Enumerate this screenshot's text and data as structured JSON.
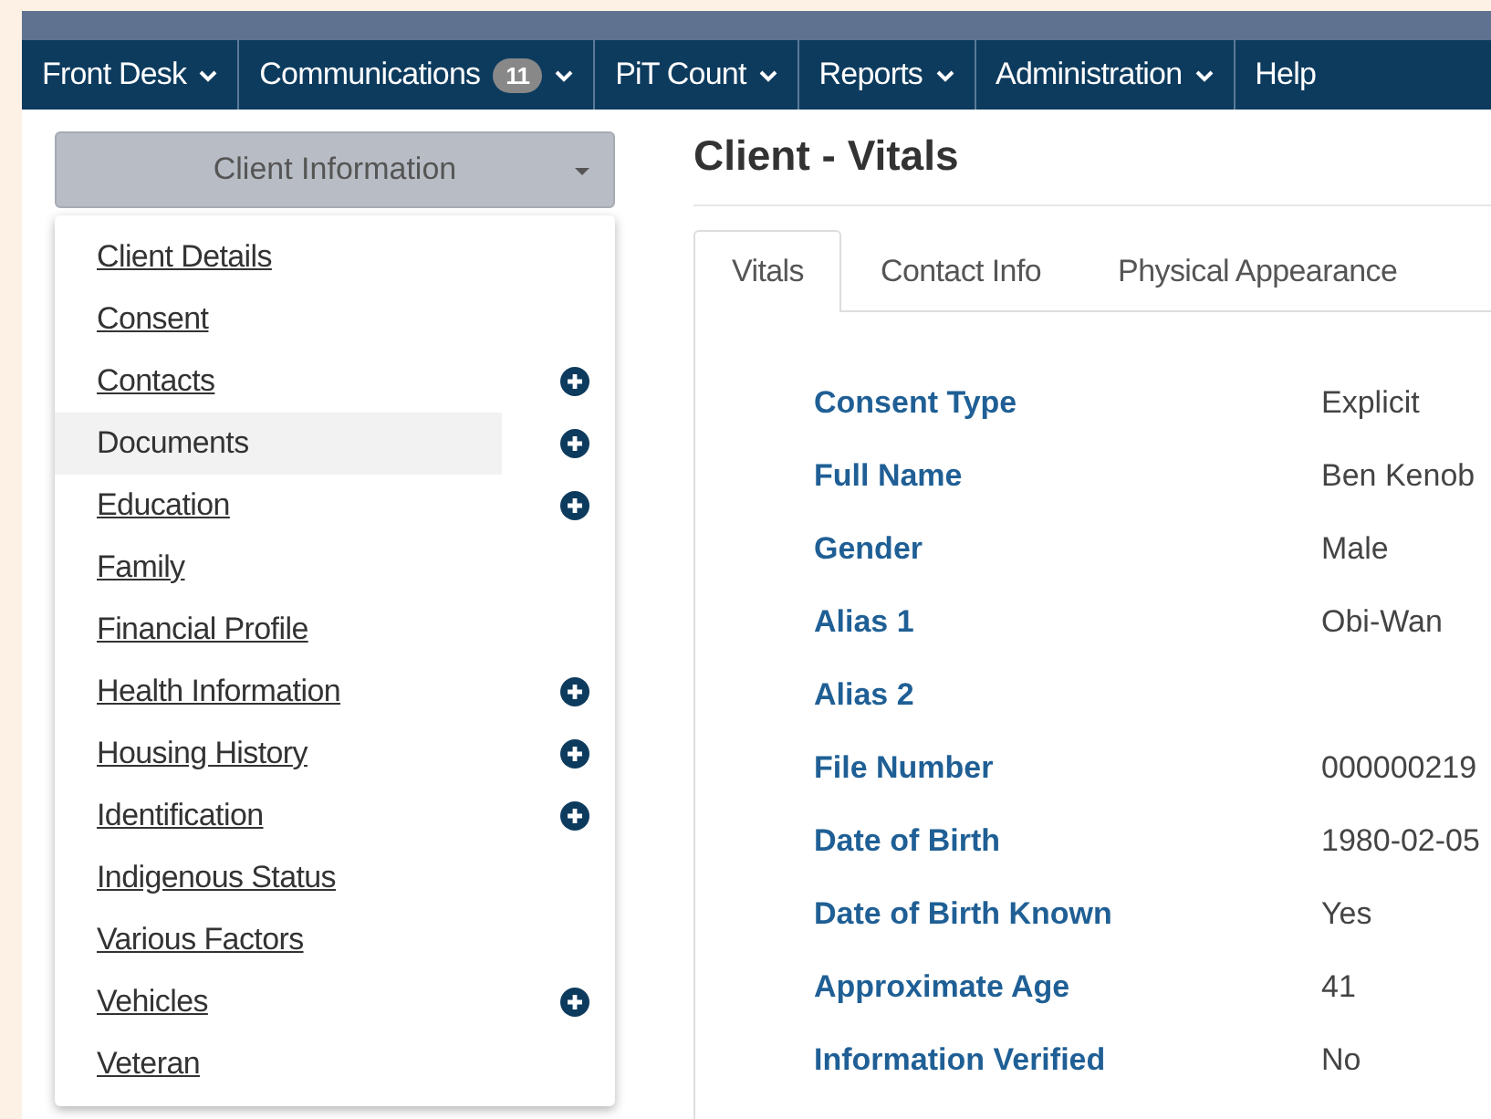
{
  "nav": [
    {
      "label": "Front Desk",
      "dropdown": true
    },
    {
      "label": "Communications",
      "badge": "11",
      "dropdown": true
    },
    {
      "label": "PiT Count",
      "dropdown": true
    },
    {
      "label": "Reports",
      "dropdown": true
    },
    {
      "label": "Administration",
      "dropdown": true
    },
    {
      "label": "Help",
      "dropdown": false
    }
  ],
  "section_menu": {
    "button": "Client Information",
    "items": [
      {
        "label": "Client Details",
        "hovered": false,
        "add": false
      },
      {
        "label": "Consent",
        "hovered": false,
        "add": false
      },
      {
        "label": "Contacts",
        "hovered": false,
        "add": true
      },
      {
        "label": "Documents",
        "hovered": true,
        "add": true
      },
      {
        "label": "Education",
        "hovered": false,
        "add": true
      },
      {
        "label": "Family",
        "hovered": false,
        "add": false
      },
      {
        "label": "Financial Profile",
        "hovered": false,
        "add": false
      },
      {
        "label": "Health Information",
        "hovered": false,
        "add": true
      },
      {
        "label": "Housing History",
        "hovered": false,
        "add": true
      },
      {
        "label": "Identification",
        "hovered": false,
        "add": true
      },
      {
        "label": "Indigenous Status",
        "hovered": false,
        "add": false
      },
      {
        "label": "Various Factors",
        "hovered": false,
        "add": false
      },
      {
        "label": "Vehicles",
        "hovered": false,
        "add": true
      },
      {
        "label": "Veteran",
        "hovered": false,
        "add": false
      }
    ]
  },
  "page_title": "Client - Vitals",
  "tabs": [
    {
      "label": "Vitals",
      "selected": true
    },
    {
      "label": "Contact Info",
      "selected": false
    },
    {
      "label": "Physical Appearance",
      "selected": false
    }
  ],
  "fields": [
    {
      "label": "Consent Type",
      "value": "Explicit"
    },
    {
      "label": "Full Name",
      "value": "Ben Kenob"
    },
    {
      "label": "Gender",
      "value": "Male"
    },
    {
      "label": "Alias 1",
      "value": "Obi-Wan"
    },
    {
      "label": "Alias 2"
    },
    {
      "label": "File Number",
      "value": "000000219"
    },
    {
      "label": "Date of Birth",
      "value": "1980-02-05"
    },
    {
      "label": "Date of Birth Known",
      "value": "Yes"
    },
    {
      "label": "Approximate Age",
      "value": "41"
    },
    {
      "label": "Information Verified",
      "value": "No"
    }
  ]
}
